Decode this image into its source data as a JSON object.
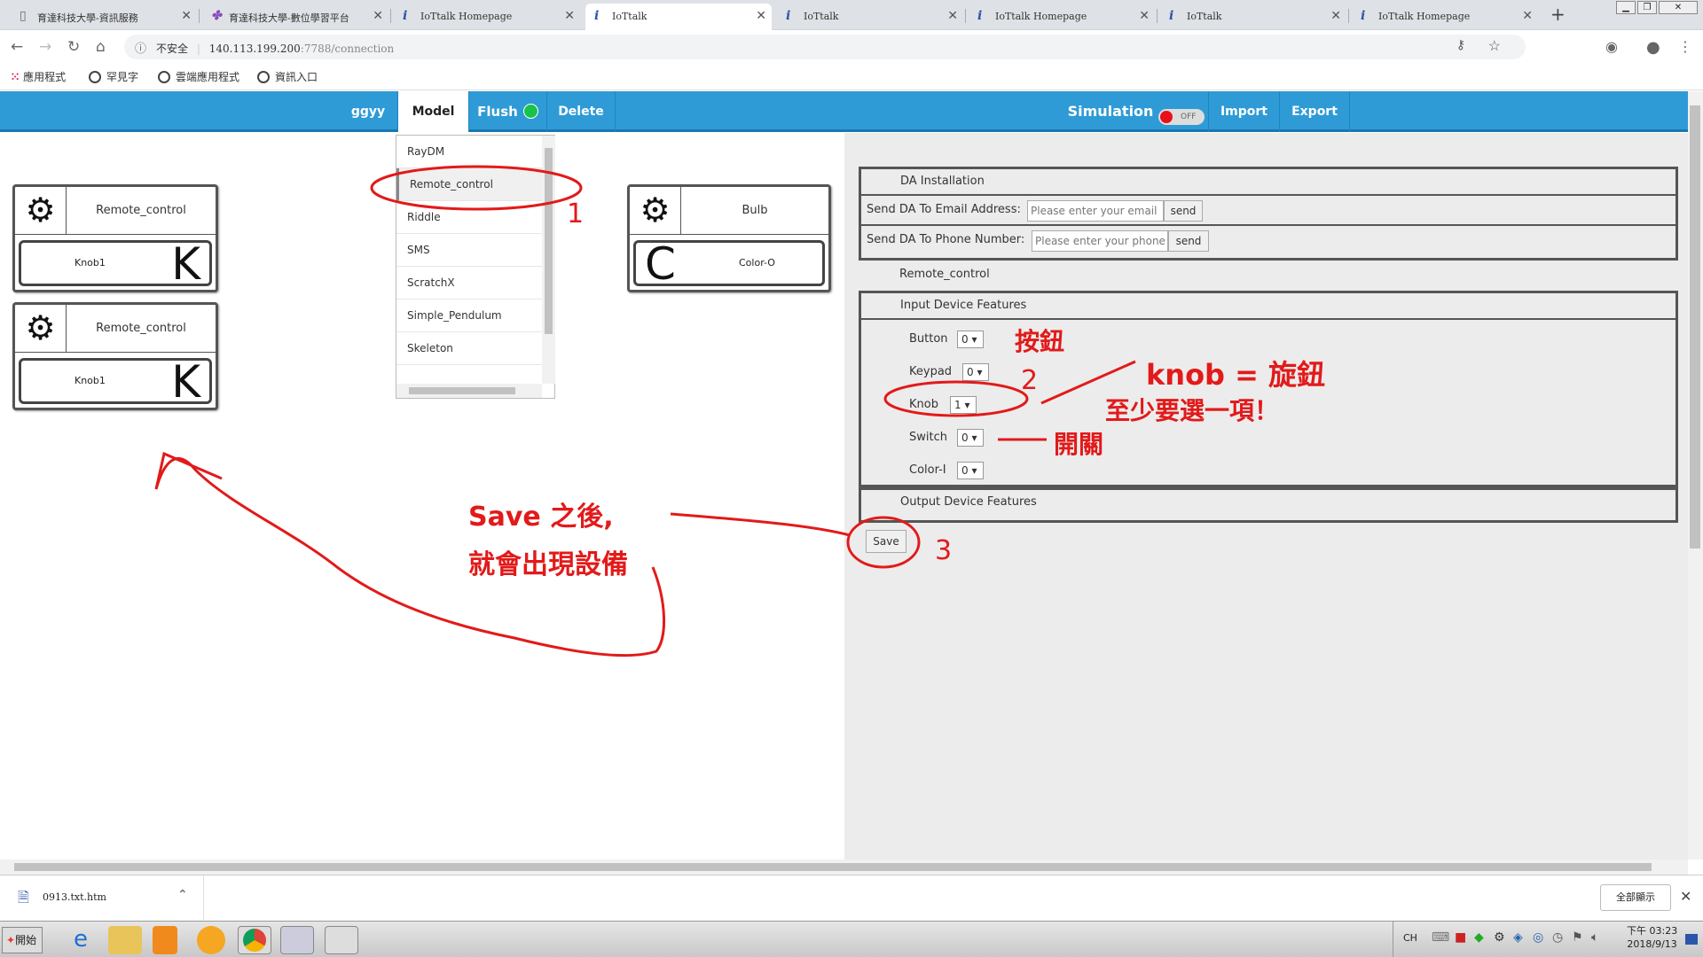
{
  "browser": {
    "tabs": [
      {
        "title": "育達科技大學-資訊服務",
        "icon": "page-icon"
      },
      {
        "title": "育達科技大學-數位學習平台",
        "icon": "colorful-logo-icon"
      },
      {
        "title": "IoTtalk Homepage",
        "icon": "info-icon"
      },
      {
        "title": "IoTtalk",
        "icon": "info-icon"
      },
      {
        "title": "IoTtalk",
        "icon": "info-icon"
      },
      {
        "title": "IoTtalk Homepage",
        "icon": "info-icon"
      },
      {
        "title": "IoTtalk",
        "icon": "info-icon"
      },
      {
        "title": "IoTtalk Homepage",
        "icon": "info-icon"
      }
    ],
    "new_tab": "+",
    "security_label": "不安全",
    "url_host": "140.113.199.200",
    "url_rest": ":7788/connection",
    "bookmarks": [
      "應用程式",
      "罕見字",
      "雲端應用程式",
      "資訊入口"
    ]
  },
  "iottalk": {
    "project": "ggyy",
    "menu_model": "Model",
    "menu_flush": "Flush",
    "menu_delete": "Delete",
    "simulation": "Simulation",
    "toggle_state": "OFF",
    "menu_import": "Import",
    "menu_export": "Export",
    "flush_color": "#17c34a",
    "toggle_dot_color": "#e8111a"
  },
  "dropdown": {
    "items": [
      "RayDM",
      "Remote_control",
      "Riddle",
      "SMS",
      "ScratchX",
      "Simple_Pendulum",
      "Skeleton"
    ],
    "selected": "Remote_control"
  },
  "devices": [
    {
      "title": "Remote_control",
      "feature": "Knob1",
      "letter": "K"
    },
    {
      "title": "Remote_control",
      "feature": "Knob1",
      "letter": "K"
    },
    {
      "title": "Bulb",
      "feature": "Color-O",
      "letter": "C"
    }
  ],
  "panel": {
    "da_installation": "DA Installation",
    "email_label": "Send DA To Email Address:",
    "email_placeholder": "Please enter your email",
    "phone_label": "Send DA To Phone Number:",
    "phone_placeholder": "Please enter your phone",
    "send": "send",
    "model_name": "Remote_control",
    "input_features": "Input Device Features",
    "features": [
      {
        "label": "Button",
        "value": "0"
      },
      {
        "label": "Keypad",
        "value": "0"
      },
      {
        "label": "Knob",
        "value": "1"
      },
      {
        "label": "Switch",
        "value": "0"
      },
      {
        "label": "Color-I",
        "value": "0"
      }
    ],
    "output_features": "Output Device Features",
    "save": "Save"
  },
  "annotations": {
    "step1": "1",
    "step2": "2",
    "step3": "3",
    "button_note": "按鈕",
    "knob_note_1": "knob = 旋鈕",
    "knob_note_2": "至少要選一項！",
    "switch_note": "開關",
    "save_note_1": "Save 之後,",
    "save_note_2": "就會出現設備"
  },
  "downloads": {
    "file": "0913.txt.htm",
    "show_all": "全部顯示"
  },
  "taskbar": {
    "start": "開始",
    "lang": "CH",
    "time": "下午 03:23",
    "date": "2018/9/13"
  }
}
